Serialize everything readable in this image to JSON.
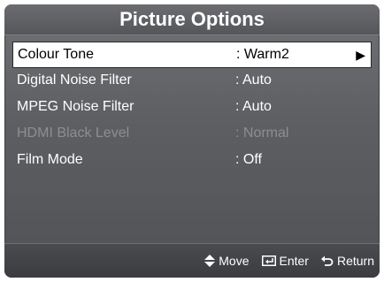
{
  "title": "Picture Options",
  "menu": {
    "items": [
      {
        "label": "Colour Tone",
        "value": ": Warm2",
        "selected": true,
        "disabled": false,
        "arrow": "▶"
      },
      {
        "label": "Digital Noise Filter",
        "value": ": Auto",
        "selected": false,
        "disabled": false
      },
      {
        "label": "MPEG Noise Filter",
        "value": ": Auto",
        "selected": false,
        "disabled": false
      },
      {
        "label": "HDMI Black Level",
        "value": ": Normal",
        "selected": false,
        "disabled": true
      },
      {
        "label": "Film Mode",
        "value": ": Off",
        "selected": false,
        "disabled": false
      }
    ]
  },
  "footer": {
    "move_label": "Move",
    "enter_label": "Enter",
    "return_label": "Return",
    "move_icon": "up-down-arrow-icon",
    "enter_icon": "enter-icon",
    "return_icon": "return-icon"
  },
  "colors": {
    "panel": "#5d5e62",
    "selected_bg": "#ffffff",
    "disabled_text": "#8d8e92",
    "text": "#ffffff"
  }
}
